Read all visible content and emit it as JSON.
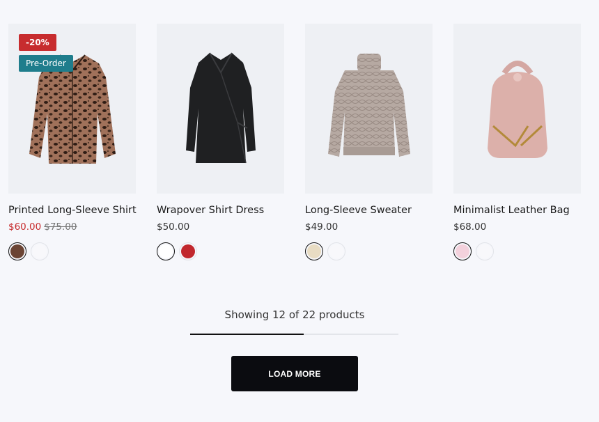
{
  "products": [
    {
      "title": "Printed Long-Sleeve Shirt",
      "price": "$60.00",
      "old_price": "$75.00",
      "on_sale": true,
      "badges": {
        "sale": "-20%",
        "preorder": "Pre-Order"
      },
      "swatches": [
        "#6b4434",
        "#f8f8fb"
      ],
      "active_swatch": 0
    },
    {
      "title": "Wrapover Shirt Dress",
      "price": "$50.00",
      "swatches": [
        "#ffffff",
        "#c1272d"
      ],
      "active_swatch": 0
    },
    {
      "title": "Long-Sleeve Sweater",
      "price": "$49.00",
      "swatches": [
        "#e8dcc3",
        "#f8f8fb"
      ],
      "active_swatch": 0
    },
    {
      "title": "Minimalist Leather Bag",
      "price": "$68.00",
      "swatches": [
        "#f3d1dc",
        "#f8f8fb"
      ],
      "active_swatch": 0
    }
  ],
  "pagination": {
    "showing_text": "Showing 12 of 22 products",
    "shown": 12,
    "total": 22,
    "load_more_label": "LOAD MORE"
  },
  "colors": {
    "sale": "#c72c2e",
    "preorder": "#1f7d8c",
    "button": "#0b0c10",
    "background": "#f6f7fb"
  }
}
